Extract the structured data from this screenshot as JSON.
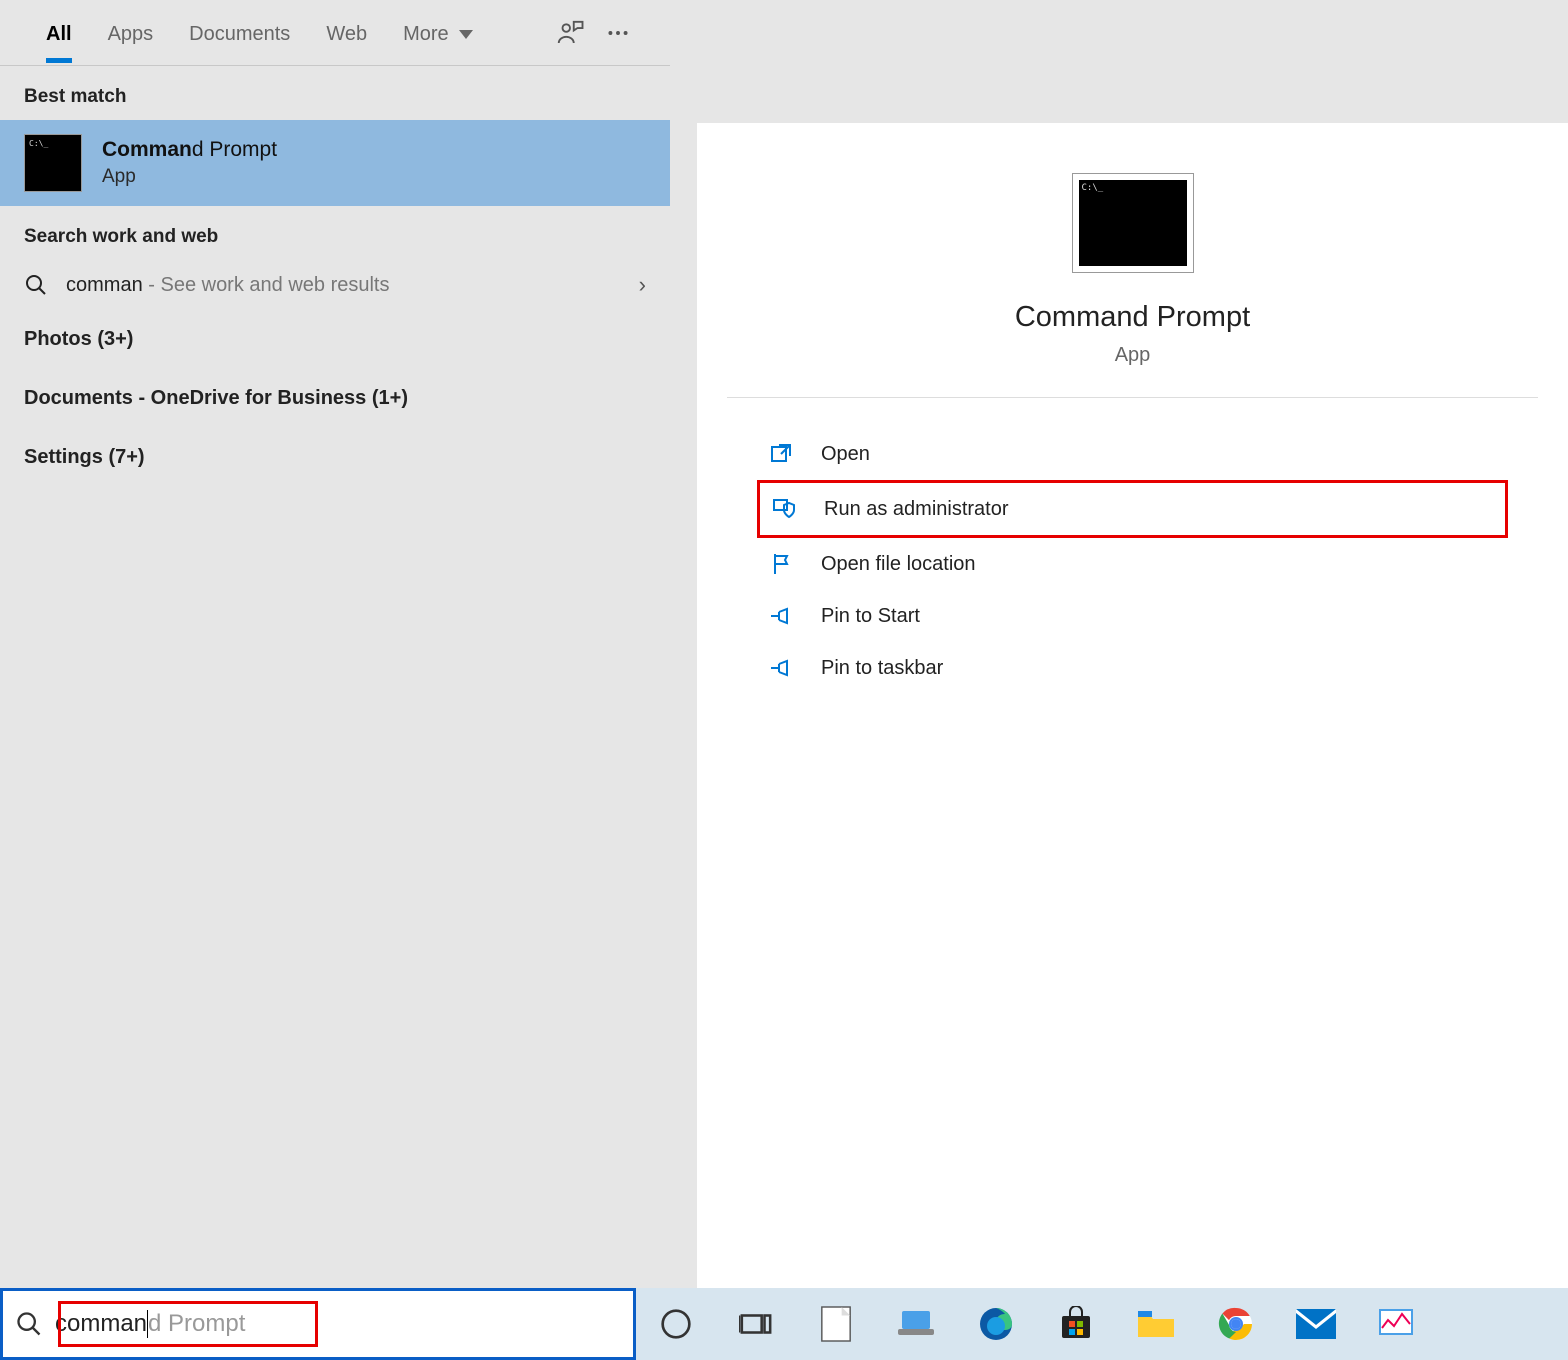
{
  "tabs": {
    "all": "All",
    "apps": "Apps",
    "documents": "Documents",
    "web": "Web",
    "more": "More"
  },
  "sections": {
    "best_match": "Best match",
    "search_work_web": "Search work and web"
  },
  "best_match_result": {
    "title_bold": "Comman",
    "title_rest": "d Prompt",
    "subtitle": "App"
  },
  "web_result": {
    "query": "comman",
    "hint": " - See work and web results"
  },
  "categories": {
    "photos": "Photos (3+)",
    "documents": "Documents - OneDrive for Business (1+)",
    "settings": "Settings (7+)"
  },
  "preview": {
    "title": "Command Prompt",
    "subtitle": "App"
  },
  "actions": {
    "open": "Open",
    "run_admin": "Run as administrator",
    "open_location": "Open file location",
    "pin_start": "Pin to Start",
    "pin_taskbar": "Pin to taskbar"
  },
  "search_box": {
    "typed": "comman",
    "suggestion": "d Prompt"
  }
}
